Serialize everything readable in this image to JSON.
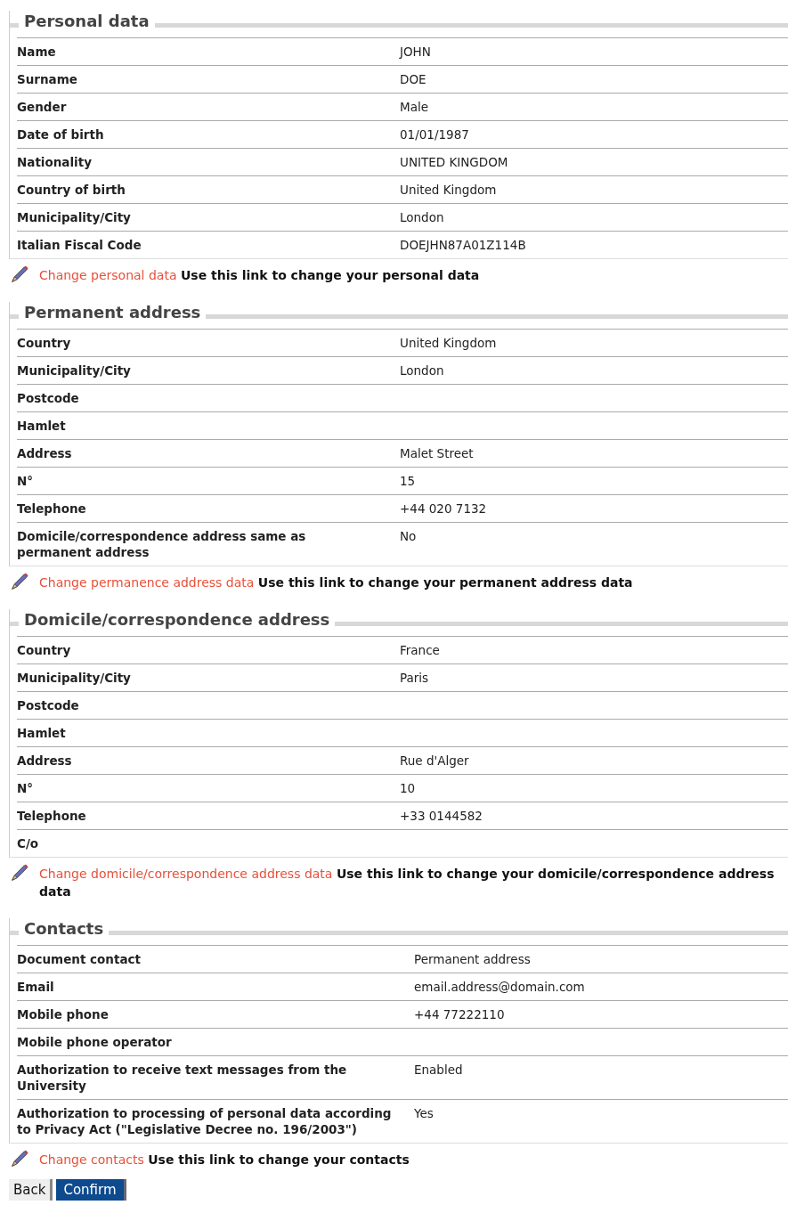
{
  "sections": [
    {
      "title": "Personal data",
      "rows": [
        {
          "label": "Name",
          "value": "JOHN"
        },
        {
          "label": "Surname",
          "value": "DOE"
        },
        {
          "label": "Gender",
          "value": "Male"
        },
        {
          "label": "Date of birth",
          "value": "01/01/1987"
        },
        {
          "label": "Nationality",
          "value": "UNITED KINGDOM"
        },
        {
          "label": "Country of birth",
          "value": "United Kingdom"
        },
        {
          "label": "Municipality/City",
          "value": "London"
        },
        {
          "label": "Italian Fiscal Code",
          "value": "DOEJHN87A01Z114B"
        }
      ],
      "link": "Change personal data",
      "hint": "Use this link to change your personal data"
    },
    {
      "title": "Permanent address",
      "rows": [
        {
          "label": "Country",
          "value": "United Kingdom"
        },
        {
          "label": "Municipality/City",
          "value": "London"
        },
        {
          "label": "Postcode"
        },
        {
          "label": "Hamlet"
        },
        {
          "label": "Address",
          "value": "Malet Street"
        },
        {
          "label": "N°",
          "value": "15"
        },
        {
          "label": "Telephone",
          "value": "+44 020 7132"
        },
        {
          "label": "Domicile/correspondence address same as permanent address",
          "value": "No"
        }
      ],
      "link": "Change permanence address data",
      "hint": "Use this link to change your permanent address data"
    },
    {
      "title": "Domicile/correspondence address",
      "rows": [
        {
          "label": "Country",
          "value": "France"
        },
        {
          "label": "Municipality/City",
          "value": "Paris"
        },
        {
          "label": "Postcode"
        },
        {
          "label": "Hamlet"
        },
        {
          "label": "Address",
          "value": "Rue d'Alger"
        },
        {
          "label": "N°",
          "value": "10"
        },
        {
          "label": "Telephone",
          "value": "+33 0144582"
        },
        {
          "label": "C/o"
        }
      ],
      "link": "Change domicile/correspondence address data",
      "hint": "Use this link to change your domicile/correspondence address data"
    },
    {
      "title": "Contacts",
      "rows": [
        {
          "label": "Document contact",
          "value": "Permanent address"
        },
        {
          "label": "Email",
          "value": "email.address@domain.com"
        },
        {
          "label": "Mobile phone",
          "value": "+44 77222110"
        },
        {
          "label": "Mobile phone operator"
        },
        {
          "label": "Authorization to receive text messages from the University",
          "value": "Enabled"
        },
        {
          "label": "Authorization to processing of personal data according to Privacy Act (\"Legislative Decree no. 196/2003\")",
          "value": "Yes"
        }
      ],
      "link": "Change contacts",
      "hint": "Use this link to change your contacts"
    }
  ],
  "buttons": [
    {
      "label": "Back",
      "kind": "secondary"
    },
    {
      "label": "Confirm",
      "kind": "primary"
    }
  ]
}
